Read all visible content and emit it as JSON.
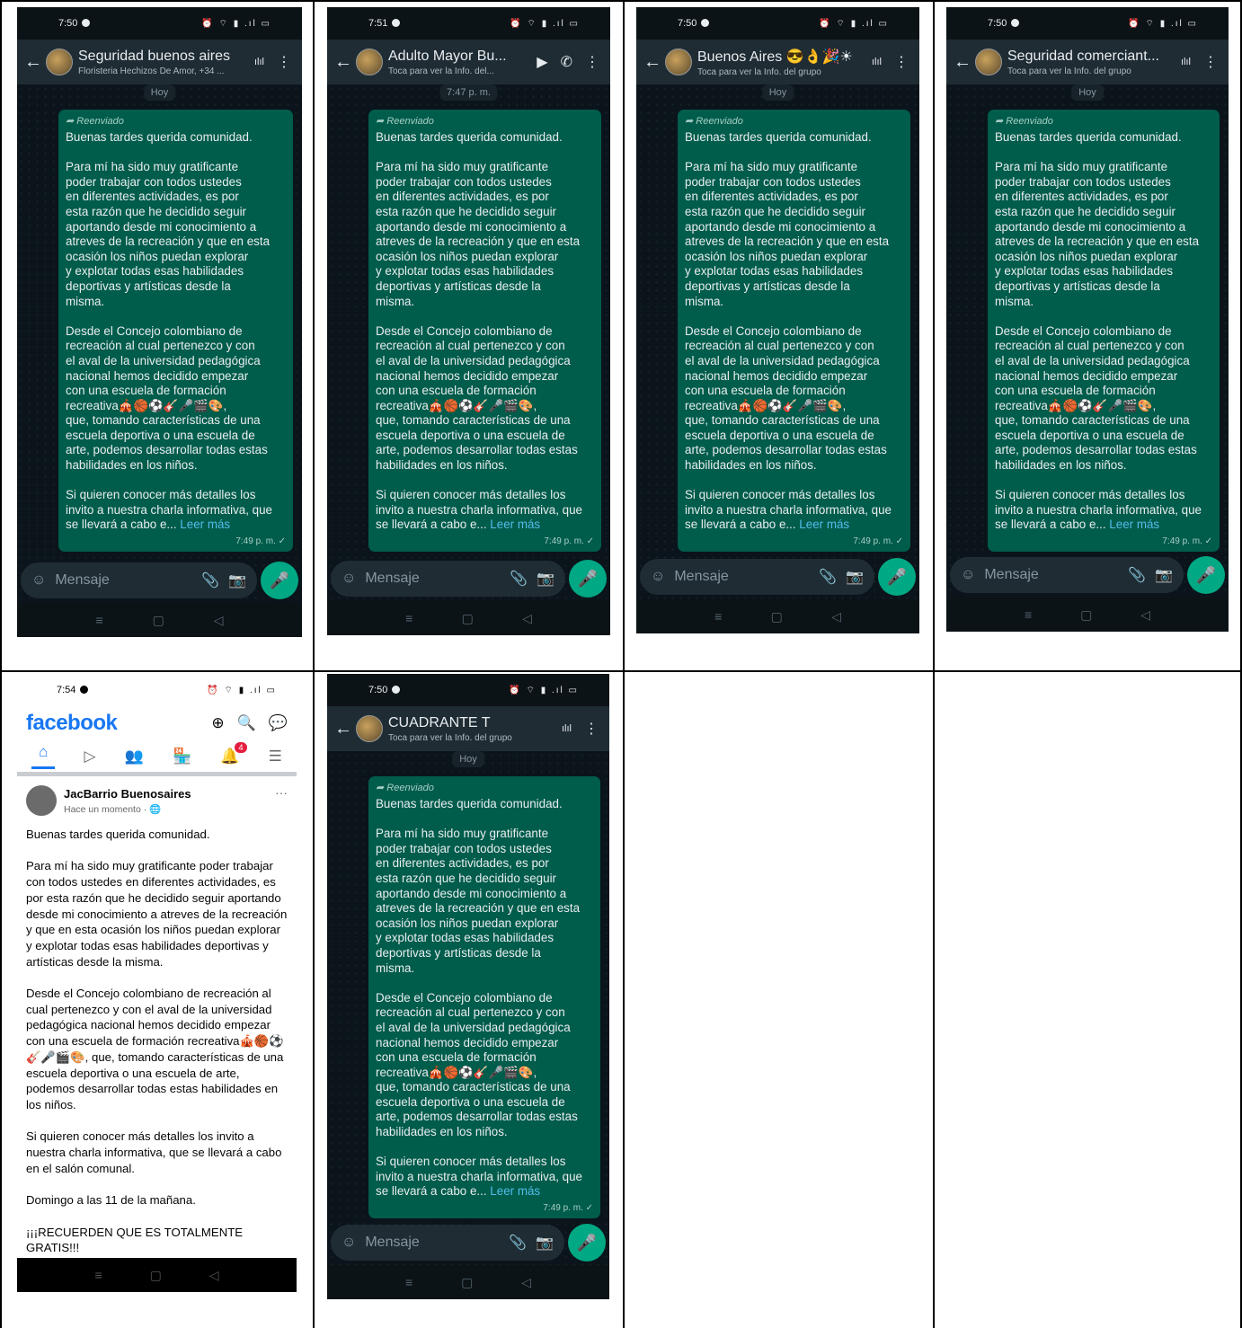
{
  "common": {
    "day_chip": "Hoy",
    "forwarded": "Reenviado",
    "message_time": "7:49 p. m. ✓",
    "message_placeholder": "Mensaje",
    "read_more": "Leer más",
    "message_body": "Buenas tardes querida comunidad.\n\nPara mí ha sido muy gratificante\npoder trabajar con todos ustedes\nen diferentes actividades, es por\nesta razón que he decidido seguir\naportando desde mi conocimiento a\natreves de la recreación y que en esta\nocasión los niños puedan explorar\ny explotar todas esas habilidades\ndeportivas y artísticas desde la\nmisma.\n\nDesde el Concejo colombiano de\nrecreación al cual pertenezco y con\nel aval de la universidad pedagógica\nnacional hemos decidido empezar\ncon una escuela de formación\nrecreativa🎪🏀⚽🎸🎤🎬🎨,\nque, tomando características de una\nescuela deportiva o una escuela de\narte, podemos desarrollar todas estas\nhabilidades en los niños.\n\nSi quieren conocer más detalles los\ninvito a nuestra charla informativa, que\nse llevará a cabo e... "
  },
  "chats": [
    {
      "time": "7:50",
      "name": "Seguridad buenos aires",
      "subtitle": "Floristeria Hechizos De Amor, +34 ...",
      "day": "Hoy"
    },
    {
      "time": "7:51",
      "name": "Adulto Mayor Bu...",
      "subtitle": "Toca para ver la Info. del...",
      "day": "7:47 p. m."
    },
    {
      "time": "7:50",
      "name": "Buenos Aires 😎👌🎉☀",
      "subtitle": "Toca para ver la Info. del grupo",
      "day": "Hoy"
    },
    {
      "time": "7:50",
      "name": "Seguridad comerciant...",
      "subtitle": "Toca para ver la Info. del grupo",
      "day": "Hoy"
    },
    {
      "time": "7:50",
      "name": "CUADRANTE T",
      "subtitle": "Toca para ver la Info. del grupo",
      "day": "Hoy"
    }
  ],
  "facebook": {
    "time": "7:54",
    "logo": "facebook",
    "notif_badge": "4",
    "author": "JacBarrio Buenosaires",
    "post_time": "Hace un momento · 🌐",
    "more": "···",
    "body": "Buenas tardes querida comunidad.\n\nPara mí ha sido muy gratificante poder trabajar con todos ustedes en diferentes actividades, es por esta razón que he decidido seguir aportando desde mi conocimiento a atreves de la recreación y que en esta ocasión los niños puedan explorar y explotar todas esas habilidades deportivas y artísticas desde la misma.\n\nDesde el Concejo colombiano de recreación al cual pertenezco y con el aval de la universidad pedagógica nacional hemos decidido empezar con una escuela de formación recreativa🎪🏀⚽🎸🎤🎬🎨, que, tomando características de una escuela deportiva o una escuela de arte, podemos desarrollar todas estas habilidades en los niños.\n\nSi quieren conocer más detalles los invito a nuestra charla informativa, que se llevará a cabo en el salón comunal.\n\nDomingo a las 11 de la mañana.\n\n¡¡¡RECUERDEN QUE ES TOTALMENTE GRATIS!!!"
  },
  "icons": {
    "back": "←",
    "more": "⋮",
    "audio": "ılıl",
    "video": "▶",
    "call": "✆",
    "emoji": "☺",
    "attach": "📎",
    "camera": "📷",
    "mic": "🎤",
    "nav_menu": "≡",
    "nav_home": "▢",
    "nav_back": "◁",
    "status": "⏰ ⌔ ▮ .ıl ▭"
  }
}
